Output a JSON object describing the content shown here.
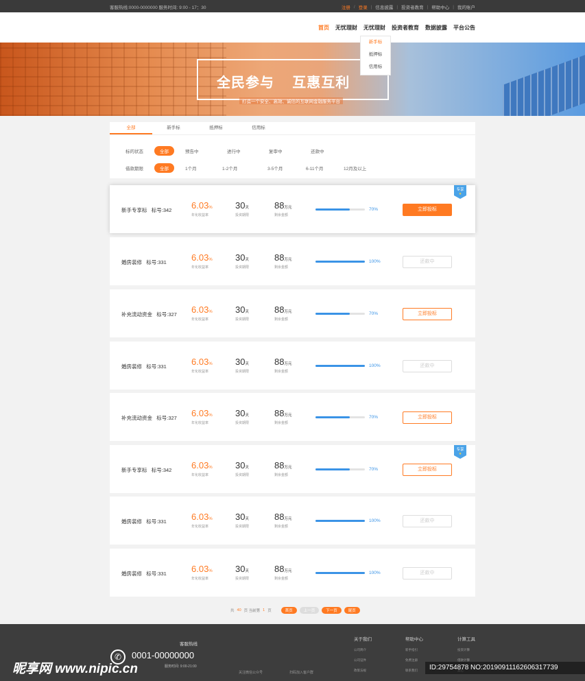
{
  "topbar": {
    "hotline": "客服热线:0000-0000000  服务时间: 9:00 - 17：30",
    "register": "注册",
    "slash": "/",
    "login": "登录",
    "links": [
      "信息披露",
      "投资者教育",
      "帮助中心",
      "我的账户"
    ]
  },
  "nav": {
    "items": [
      "首页",
      "无忧理财",
      "无忧理财",
      "投资者教育",
      "数据披露",
      "平台公告"
    ],
    "dropdown": [
      "新手标",
      "抵押标",
      "信用标"
    ]
  },
  "banner": {
    "slogan": "全民参与    互惠互利",
    "subtitle": "打造一个安全、高效、诚信的互联网金融服务平台"
  },
  "filter": {
    "tabs": [
      "全部",
      "新手标",
      "抵押标",
      "信用标"
    ],
    "status_label": "标的状态",
    "status_options": [
      "全部",
      "预告中",
      "进行中",
      "复审中",
      "还款中"
    ],
    "term_label": "借款期限",
    "term_options": [
      "全部",
      "1个月",
      "1-2个月",
      "3-5个月",
      "6-11个月",
      "12月及以上"
    ]
  },
  "captions": {
    "rate": "年化收益率",
    "term": "投资期限",
    "remain": "剩余金额",
    "percent_unit": "%",
    "day_unit": "天",
    "wan_unit": "万元"
  },
  "loans": [
    {
      "name": "新手专享标   标号:342",
      "rate": "6.03",
      "days": "30",
      "amount": "88",
      "progress": 70,
      "progress_text": "70%",
      "button": "立即投标",
      "state": "solid",
      "badge": "专享"
    },
    {
      "name": "婚房装修   标号:331",
      "rate": "6.03",
      "days": "30",
      "amount": "88",
      "progress": 100,
      "progress_text": "100%",
      "button": "还款中",
      "state": "off",
      "badge": ""
    },
    {
      "name": "补充流动资金   标号:327",
      "rate": "6.03",
      "days": "30",
      "amount": "88",
      "progress": 70,
      "progress_text": "70%",
      "button": "立即投标",
      "state": "outline",
      "badge": ""
    },
    {
      "name": "婚房装修   标号:331",
      "rate": "6.03",
      "days": "30",
      "amount": "88",
      "progress": 100,
      "progress_text": "100%",
      "button": "还款中",
      "state": "off",
      "badge": ""
    },
    {
      "name": "补充流动资金   标号:327",
      "rate": "6.03",
      "days": "30",
      "amount": "88",
      "progress": 70,
      "progress_text": "70%",
      "button": "立即投标",
      "state": "outline",
      "badge": ""
    },
    {
      "name": "新手专享标   标号:342",
      "rate": "6.03",
      "days": "30",
      "amount": "88",
      "progress": 70,
      "progress_text": "70%",
      "button": "立即投标",
      "state": "outline",
      "badge": "专享"
    },
    {
      "name": "婚房装修   标号:331",
      "rate": "6.03",
      "days": "30",
      "amount": "88",
      "progress": 100,
      "progress_text": "100%",
      "button": "还款中",
      "state": "off",
      "badge": ""
    },
    {
      "name": "婚房装修   标号:331",
      "rate": "6.03",
      "days": "30",
      "amount": "88",
      "progress": 100,
      "progress_text": "100%",
      "button": "还款中",
      "state": "off",
      "badge": ""
    }
  ],
  "pager": {
    "total_prefix": "共",
    "total": "40",
    "total_suffix": "页  当前第",
    "current": "1",
    "current_suffix": "页",
    "first": "首页",
    "prev": "上一页",
    "next": "下一页",
    "last": "尾页"
  },
  "footer": {
    "hotline_title": "客服热线",
    "phone": "0001-00000000",
    "service_time": "服务时间: 9:00-21:00",
    "wechat": "关注微信公众号",
    "app": "扫码加入客户群",
    "columns": [
      {
        "title": "关于我们",
        "items": [
          "公司简介",
          "公司证件",
          "政策法规"
        ]
      },
      {
        "title": "帮助中心",
        "items": [
          "新手指引",
          "免费注册",
          "联系我们"
        ]
      },
      {
        "title": "计算工具",
        "items": [
          "投资计算",
          "借款计算",
          "其它"
        ]
      }
    ]
  },
  "watermark": {
    "site": "昵享网 www.nipic.cn",
    "id": "ID:29754878 NO:20190911162606317739"
  },
  "colors": {
    "accent": "#ff7a22",
    "progress": "#3a93e6"
  }
}
